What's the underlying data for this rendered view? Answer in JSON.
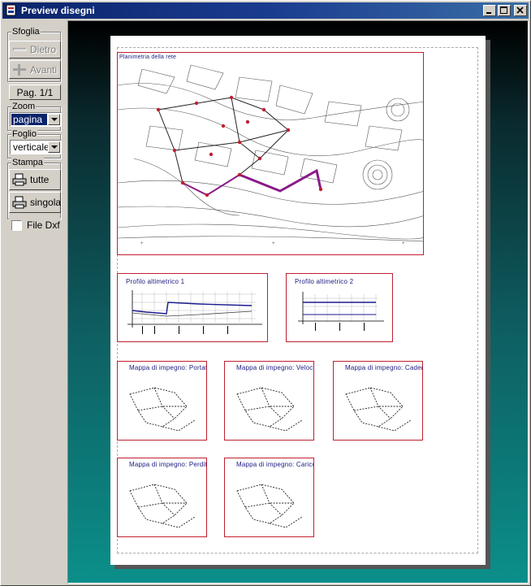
{
  "window": {
    "title": "Preview disegni"
  },
  "sidebar": {
    "sfoglia": {
      "label": "Sfoglia",
      "back_label": "Dietro",
      "forward_label": "Avanti"
    },
    "page_label": "Pag. 1/1",
    "zoom": {
      "label": "Zoom",
      "value": "pagina"
    },
    "foglio": {
      "label": "Foglio",
      "value": "verticale"
    },
    "stampa": {
      "label": "Stampa",
      "all_label": "tutte",
      "single_label": "singola"
    },
    "file_dxf": {
      "label": "File Dxf",
      "checked": false
    }
  },
  "sheet": {
    "main_map_title": "Planimetria della rete",
    "profiles": [
      {
        "title": "Profilo altimetrico 1"
      },
      {
        "title": "Profilo altimetrico 2"
      }
    ],
    "maps": [
      {
        "title": "Mappa di impegno: Portata"
      },
      {
        "title": "Mappa di impegno: Velocità"
      },
      {
        "title": "Mappa di impegno: Cadente"
      },
      {
        "title": "Mappa di impegno: Perdite"
      },
      {
        "title": "Mappa di impegno: Carico"
      }
    ]
  },
  "colors": {
    "titlebar": "#0a246a",
    "frame": "#c02030",
    "network": "#7a1a7a",
    "profile_line": "#1a1a90"
  }
}
